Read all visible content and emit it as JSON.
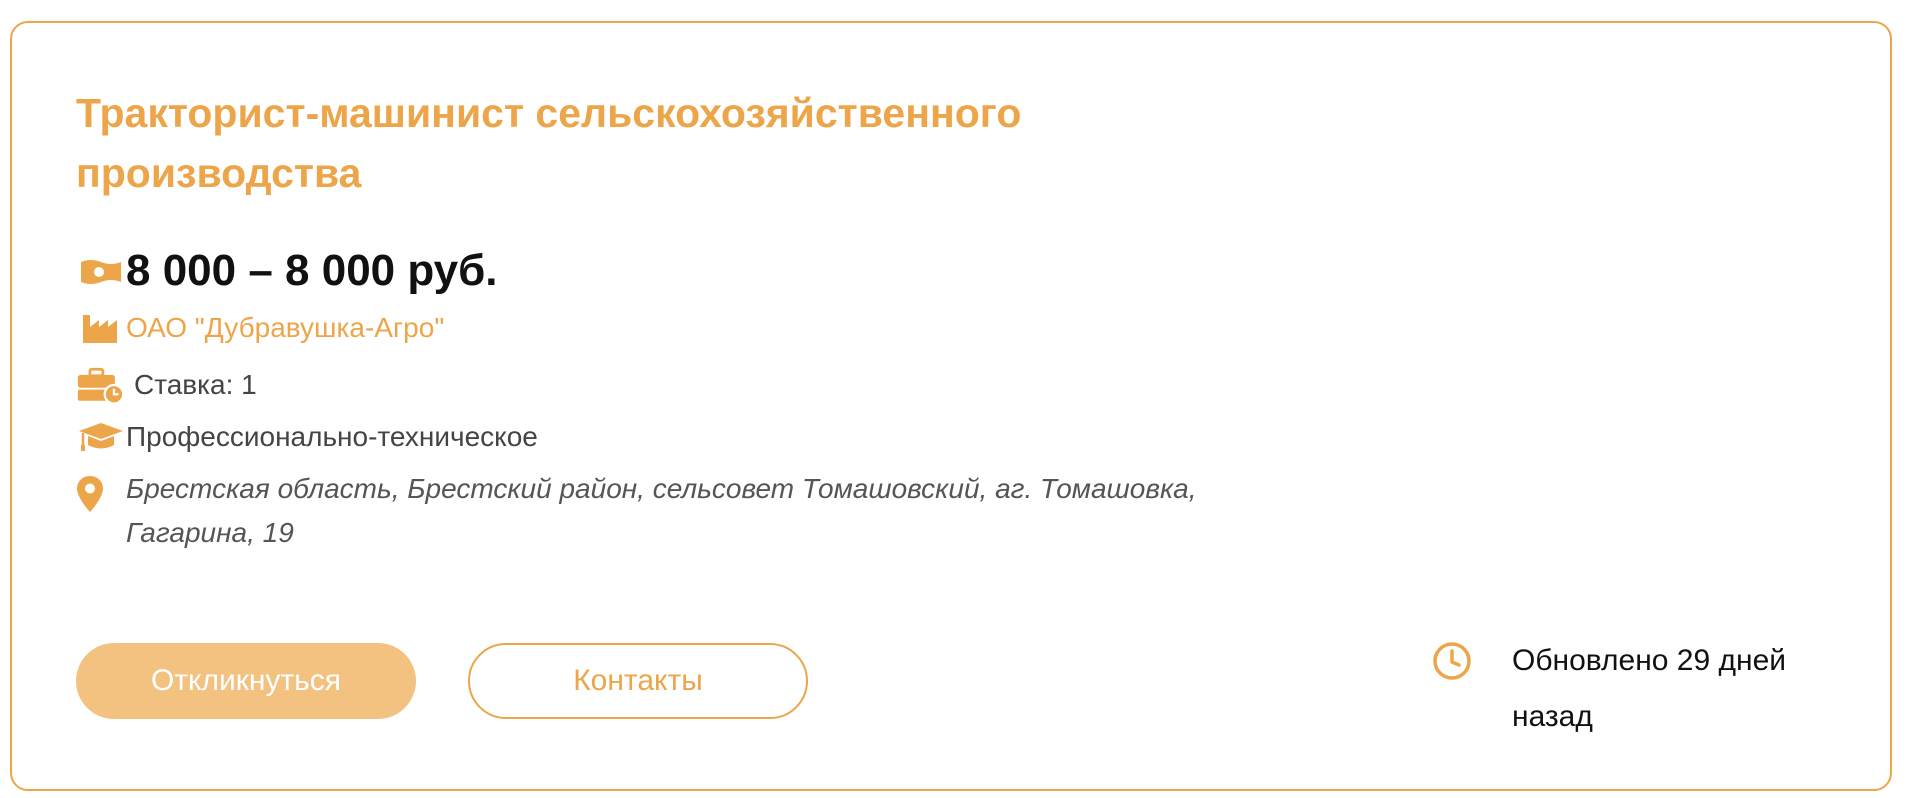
{
  "vacancy": {
    "title": "Тракторист-машинист сельскохозяйственного производства",
    "salary": "8 000 – 8 000 руб.",
    "company": "ОАО \"Дубравушка-Агро\"",
    "rate": "Ставка: 1",
    "education": "Профессионально-техническое",
    "address": "Брестская область, Брестский район, сельсовет Томашовский, аг. Томашовка, Гагарина, 19"
  },
  "actions": {
    "apply_label": "Откликнуться",
    "contacts_label": "Контакты"
  },
  "meta": {
    "updated": "Обновлено 29 дней назад"
  },
  "icons": {
    "salary": "banknote-icon",
    "company": "factory-icon",
    "rate": "briefcase-clock-icon",
    "education": "graduation-cap-icon",
    "address": "map-pin-icon",
    "updated": "clock-icon"
  },
  "colors": {
    "accent": "#eca549",
    "accent_light": "#f3c281",
    "text_dark": "#111111",
    "text_muted": "#555555"
  }
}
